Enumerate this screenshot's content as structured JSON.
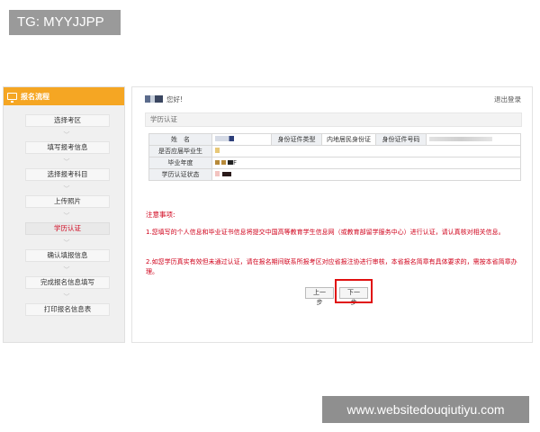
{
  "watermark_top": "TG: MYYJJPP",
  "watermark_bottom": "www.websitedouqiutiyu.com",
  "sidebar": {
    "title": "报名流程",
    "steps": [
      {
        "label": "选择考区"
      },
      {
        "label": "填写报考信息"
      },
      {
        "label": "选择报考科目"
      },
      {
        "label": "上传照片"
      },
      {
        "label": "学历认证",
        "active": true
      },
      {
        "label": "确认填报信息"
      },
      {
        "label": "完成报名信息填写"
      },
      {
        "label": "打印报名信息表"
      }
    ]
  },
  "header": {
    "greeting": "您好!",
    "logout": "退出登录"
  },
  "section_title": "学历认证",
  "table": {
    "name_label": "姓　名",
    "id_type_label": "身份证件类型",
    "id_type_value": "内地居民身份证",
    "id_number_label": "身份证件号码",
    "graduate_label": "是否应届毕业生",
    "grad_year_label": "毕业年度",
    "grad_year_value": "F",
    "status_label": "学历认证状态"
  },
  "notice": {
    "title": "注意事项:",
    "item1": "1.您填写的个人信息和毕业证书信息将提交中国高等教育学生信息网（或教育部留学服务中心）进行认证，请认真核对相关信息。",
    "item2": "2.如您学历真实有效但未通过认证，请在报名期间联系所报考区对应省报注协进行审核，本省报名简章有具体要求的，需按本省简章办理。"
  },
  "buttons": {
    "prev": "上一步",
    "next": "下一步"
  },
  "colors": {
    "accent": "#f5a623",
    "notice": "#d0021b",
    "highlight": "#e01010"
  }
}
